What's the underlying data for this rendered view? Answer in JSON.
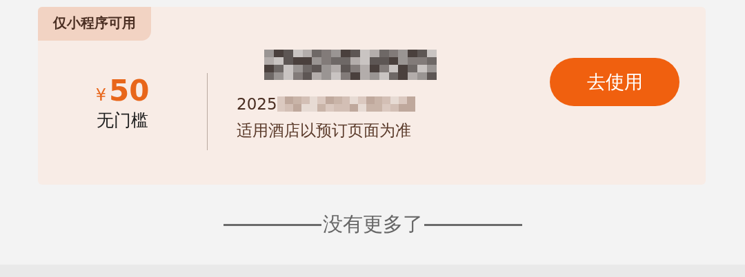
{
  "coupon": {
    "badge": "仅小程序可用",
    "currency": "¥",
    "amount": "50",
    "threshold": "无门槛",
    "title": {
      "redacted": true
    },
    "validity": {
      "text": "2025",
      "redacted": true
    },
    "rule": "适用酒店以预订页面为准",
    "button": "去使用"
  },
  "footer": "没有更多了"
}
